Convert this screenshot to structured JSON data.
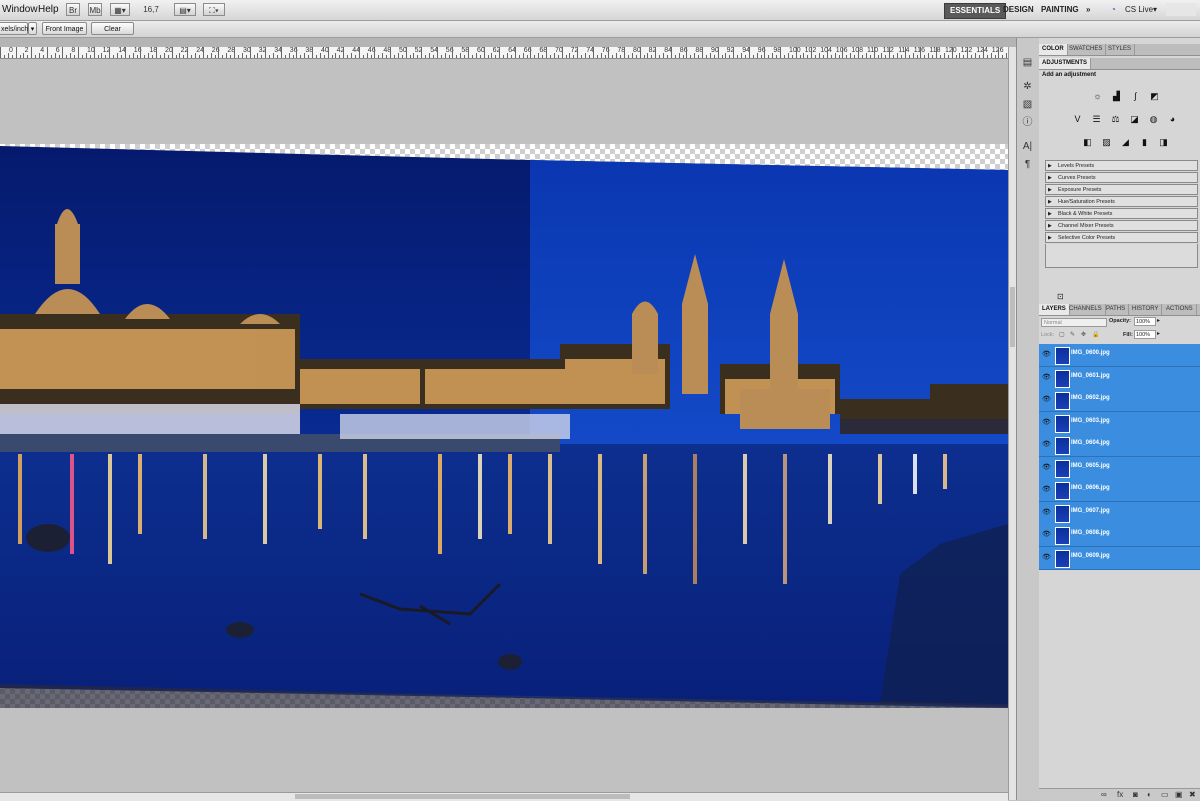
{
  "menubar": {
    "items": [
      "Window",
      "Help"
    ],
    "zoom": "16,7",
    "workspaces": [
      "ESSENTIALS",
      "DESIGN",
      "PAINTING"
    ],
    "workspace_more": "»",
    "cs_live": "CS Live"
  },
  "options": {
    "resolution_unit": "xels/inch",
    "front_image_label": "Front Image",
    "clear_label": "Clear"
  },
  "ruler": {
    "numbers": [
      "0",
      "2",
      "4",
      "6",
      "8",
      "10",
      "12",
      "14",
      "16",
      "18",
      "20",
      "22",
      "24",
      "26",
      "28",
      "30",
      "32",
      "34",
      "36",
      "38",
      "40",
      "42",
      "44",
      "46",
      "48",
      "50",
      "52",
      "54",
      "56",
      "58",
      "60",
      "62",
      "64",
      "66",
      "68",
      "70",
      "72",
      "74",
      "76",
      "78",
      "80",
      "82",
      "84",
      "86",
      "88",
      "90",
      "92",
      "94",
      "96",
      "98",
      "100",
      "102",
      "104",
      "106",
      "108",
      "110",
      "112",
      "114",
      "116",
      "118",
      "120",
      "122",
      "124",
      "126",
      "128"
    ]
  },
  "panels": {
    "top_tabs": [
      "COLOR",
      "SWATCHES",
      "STYLES"
    ],
    "adjustments_tab": "ADJUSTMENTS",
    "adjustments_title": "Add an adjustment",
    "presets": [
      "Levels Presets",
      "Curves Presets",
      "Exposure Presets",
      "Hue/Saturation Presets",
      "Black & White Presets",
      "Channel Mixer Presets",
      "Selective Color Presets"
    ],
    "layer_tabs": [
      "LAYERS",
      "CHANNELS",
      "PATHS",
      "HISTORY",
      "ACTIONS"
    ],
    "blend_mode": "Normal",
    "opacity_label": "Opacity:",
    "opacity_value": "100%",
    "lock_label": "Lock:",
    "fill_label": "Fill:",
    "fill_value": "100%",
    "layers": [
      "IMG_0600.jpg",
      "IMG_0601.jpg",
      "IMG_0602.jpg",
      "IMG_0603.jpg",
      "IMG_0604.jpg",
      "IMG_0605.jpg",
      "IMG_0606.jpg",
      "IMG_0607.jpg",
      "IMG_0608.jpg",
      "IMG_0609.jpg"
    ],
    "bottom_icons": [
      "link-icon",
      "fx-icon",
      "mask-icon",
      "adjustment-icon",
      "group-icon",
      "new-layer-icon",
      "trash-icon"
    ]
  },
  "colors": {
    "selection_blue": "#3a8ddf",
    "night_sky": "#0a2a9a",
    "water": "#0c2fa8"
  }
}
